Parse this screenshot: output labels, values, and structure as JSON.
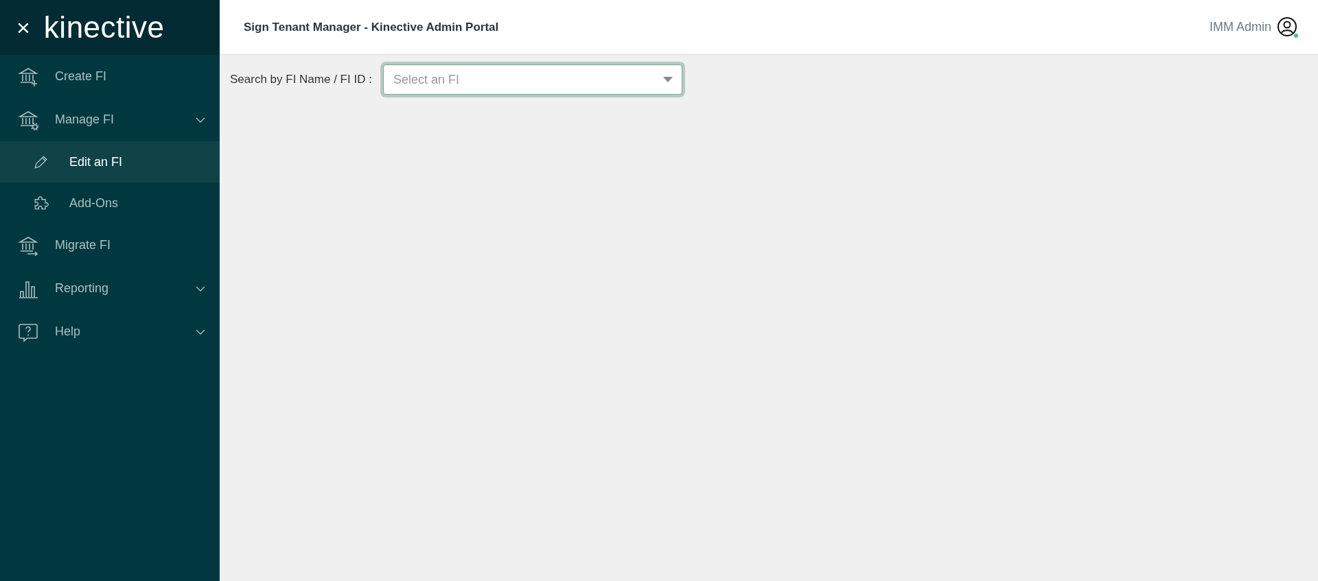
{
  "sidebar": {
    "logo": "kinective",
    "close": "×",
    "items": [
      {
        "label": "Create FI",
        "kind": "link",
        "selected": false
      },
      {
        "label": "Manage FI",
        "kind": "group",
        "selected": false,
        "children": [
          {
            "label": "Edit an FI",
            "selected": true
          },
          {
            "label": "Add-Ons",
            "selected": false
          }
        ]
      },
      {
        "label": "Migrate FI",
        "kind": "link",
        "selected": false
      },
      {
        "label": "Reporting",
        "kind": "group",
        "selected": false
      },
      {
        "label": "Help",
        "kind": "group",
        "selected": false
      }
    ]
  },
  "header": {
    "title": "Sign Tenant Manager - Kinective Admin Portal",
    "user": "IMM Admin",
    "online": true
  },
  "search": {
    "label": "Search by FI Name / FI ID :",
    "placeholder": "Select an FI"
  }
}
